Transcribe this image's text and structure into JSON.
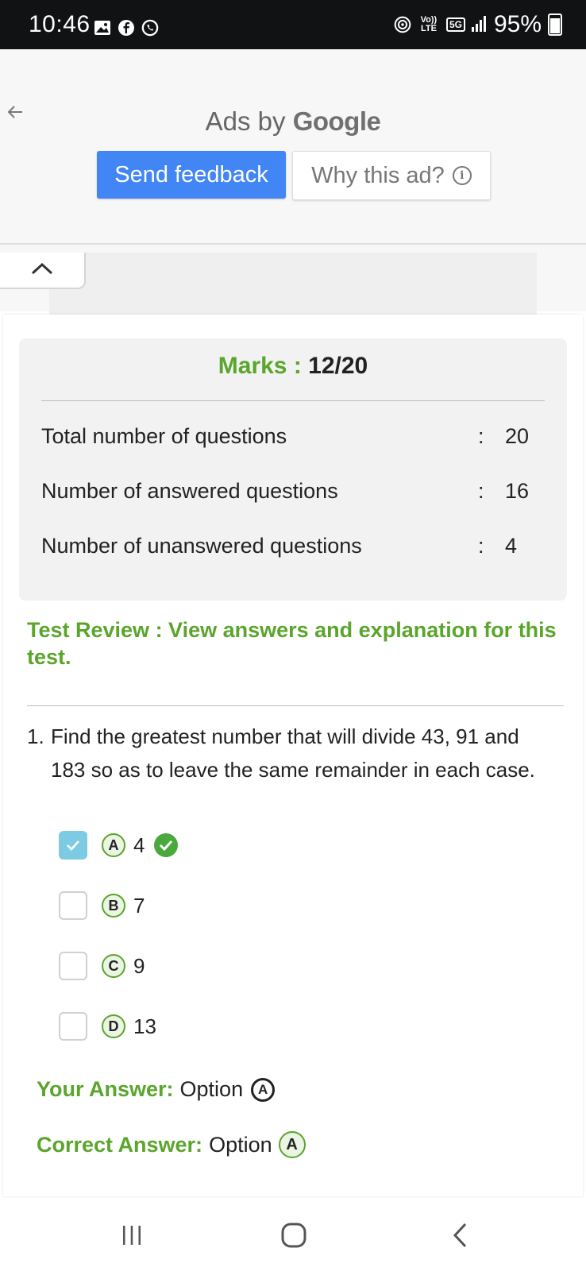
{
  "status_bar": {
    "time": "10:46",
    "left_icons": [
      "gallery-icon",
      "facebook-icon",
      "whatsapp-icon"
    ],
    "right_icons": [
      "hotspot-icon",
      "volte-icon",
      "5g-icon",
      "signal-icon"
    ],
    "volte_label": "Vo)) LTE",
    "network": "5G",
    "battery": "95%"
  },
  "ad": {
    "ads_by": "Ads by",
    "brand": "Google",
    "send_feedback": "Send feedback",
    "why_this_ad": "Why this ad?",
    "info_glyph": "i"
  },
  "score": {
    "marks_label": "Marks :",
    "marks_value": "12/20",
    "rows": [
      {
        "label": "Total number of questions",
        "colon": ":",
        "value": "20"
      },
      {
        "label": "Number of answered questions",
        "colon": ":",
        "value": "16"
      },
      {
        "label": "Number of unanswered questions",
        "colon": ":",
        "value": "4"
      }
    ]
  },
  "review": {
    "title": "Test Review : View answers and explanation for this test."
  },
  "question": {
    "number": "1.",
    "text": "Find the greatest number that will divide 43, 91 and 183 so as to leave the same remainder in each case.",
    "options": [
      {
        "letter": "A",
        "value": "4",
        "checked": true,
        "correct": true
      },
      {
        "letter": "B",
        "value": "7",
        "checked": false,
        "correct": false
      },
      {
        "letter": "C",
        "value": "9",
        "checked": false,
        "correct": false
      },
      {
        "letter": "D",
        "value": "13",
        "checked": false,
        "correct": false
      }
    ],
    "your_answer_label": "Your Answer:",
    "your_answer_text": "Option",
    "your_answer_letter": "A",
    "correct_answer_label": "Correct Answer:",
    "correct_answer_text": "Option",
    "correct_answer_letter": "A"
  },
  "colors": {
    "accent_green": "#5aa52b",
    "google_blue": "#4285f4",
    "checkbox_blue": "#7ccbe3"
  }
}
